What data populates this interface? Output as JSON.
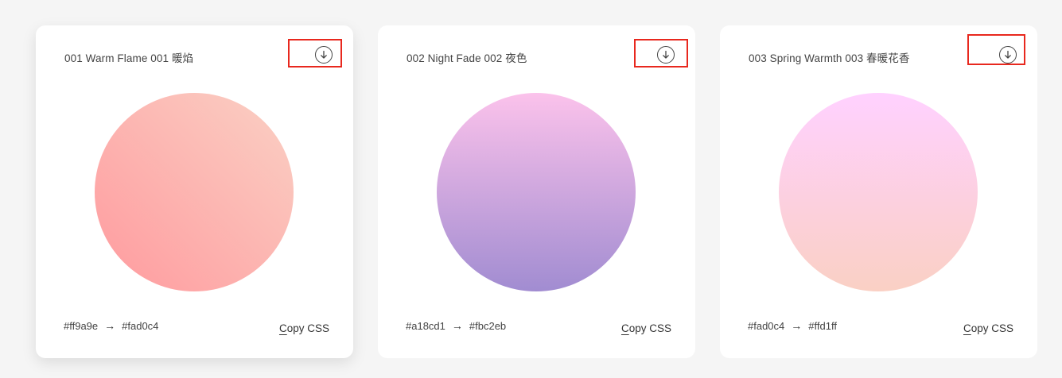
{
  "cards": [
    {
      "title": "001 Warm Flame 001 暖焰",
      "from": "#ff9a9e",
      "to": "#fad0c4",
      "arrow": "→",
      "copy_first": "C",
      "copy_rest": "opy CSS"
    },
    {
      "title": "002 Night Fade 002 夜色",
      "from": "#a18cd1",
      "to": "#fbc2eb",
      "arrow": "→",
      "copy_first": "C",
      "copy_rest": "opy CSS"
    },
    {
      "title": "003 Spring Warmth 003 春暖花香",
      "from": "#fad0c4",
      "to": "#ffd1ff",
      "arrow": "→",
      "copy_first": "C",
      "copy_rest": "opy CSS"
    }
  ],
  "colors": {
    "highlight": "#e8281e",
    "page_background": "#f5f5f5",
    "card_background": "#ffffff"
  },
  "icons": {
    "download": "download-circle-icon"
  }
}
